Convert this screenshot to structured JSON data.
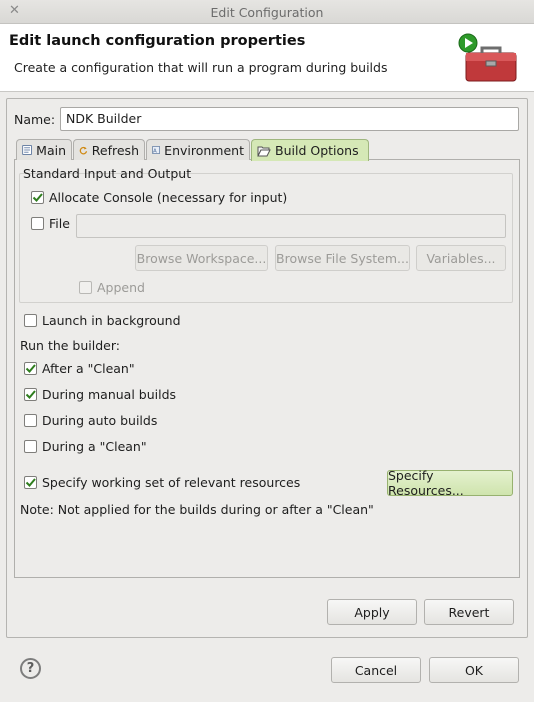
{
  "window": {
    "title": "Edit Configuration",
    "close_glyph": "✕"
  },
  "header": {
    "title": "Edit launch configuration properties",
    "description": "Create a configuration that will run a program during builds",
    "icon": "toolbox-run-icon"
  },
  "name": {
    "label": "Name:",
    "value": "NDK Builder"
  },
  "tabs": [
    {
      "label": "Main",
      "icon": "main-tab-icon",
      "active": false
    },
    {
      "label": "Refresh",
      "icon": "refresh-icon",
      "active": false
    },
    {
      "label": "Environment",
      "icon": "environment-icon",
      "active": false
    },
    {
      "label": "Build Options",
      "icon": "folder-open-icon",
      "active": true
    }
  ],
  "io_group": {
    "title": "Standard Input and Output",
    "allocate_console": {
      "label": "Allocate Console (necessary for input)",
      "checked": true
    },
    "file": {
      "label": "File",
      "checked": false,
      "value": ""
    },
    "browse_workspace": "Browse Workspace...",
    "browse_file_system": "Browse File System...",
    "variables": "Variables...",
    "append": {
      "label": "Append",
      "checked": false,
      "enabled": false
    }
  },
  "launch_background": {
    "label": "Launch in background",
    "checked": false
  },
  "run_builder": {
    "label": "Run the builder:",
    "options": [
      {
        "label": "After a \"Clean\"",
        "checked": true
      },
      {
        "label": "During manual builds",
        "checked": true
      },
      {
        "label": "During auto builds",
        "checked": false
      },
      {
        "label": "During a \"Clean\"",
        "checked": false
      }
    ]
  },
  "working_set": {
    "label": "Specify working set of relevant resources",
    "checked": true,
    "button": "Specify Resources...",
    "note": "Note: Not applied for the builds during or after a \"Clean\""
  },
  "actions": {
    "apply": "Apply",
    "revert": "Revert",
    "cancel": "Cancel",
    "ok": "OK"
  },
  "help": {
    "glyph": "?"
  },
  "colors": {
    "accent_green": "#d5e8b6",
    "check_green": "#2f7d1e"
  }
}
